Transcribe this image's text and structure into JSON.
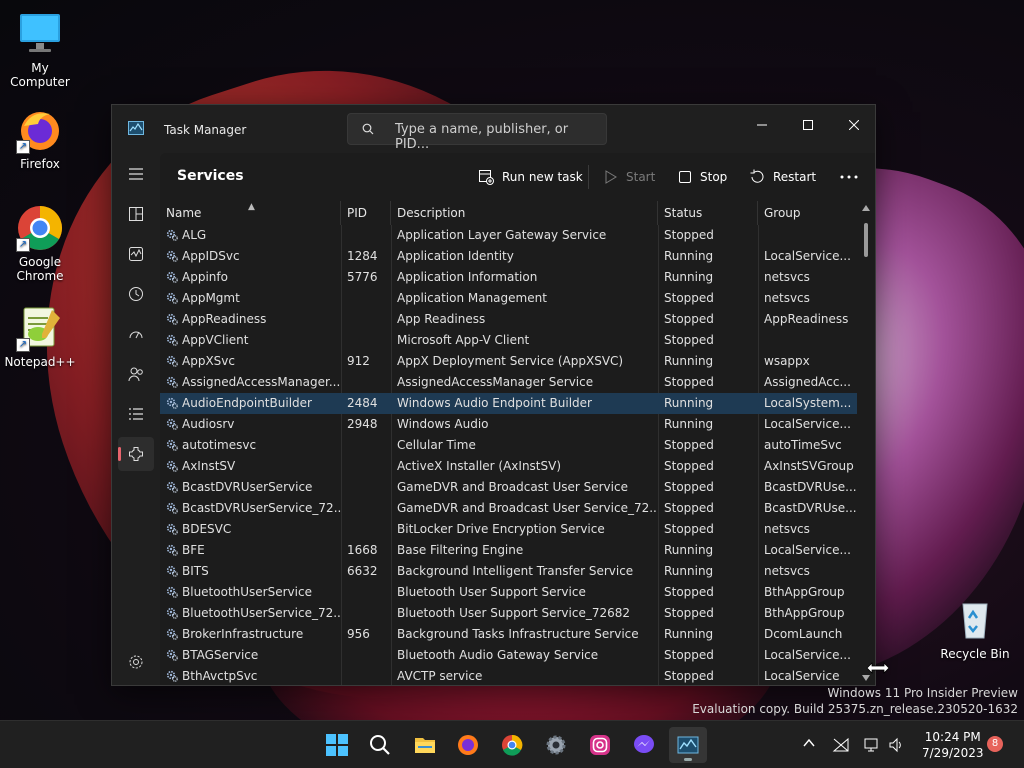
{
  "desktop": {
    "icons": [
      {
        "label": "My Computer"
      },
      {
        "label": "Firefox"
      },
      {
        "label": "Google Chrome"
      },
      {
        "label": "Notepad++"
      },
      {
        "label": "Recycle Bin"
      }
    ]
  },
  "window": {
    "title": "Task Manager",
    "search_placeholder": "Type a name, publisher, or PID..."
  },
  "toolbar": {
    "page_title": "Services",
    "run_new_task": "Run new task",
    "start": "Start",
    "stop": "Stop",
    "restart": "Restart"
  },
  "table": {
    "columns": [
      "Name",
      "PID",
      "Description",
      "Status",
      "Group"
    ],
    "selected_index": 8,
    "rows": [
      {
        "name": "ALG",
        "pid": "",
        "description": "Application Layer Gateway Service",
        "status": "Stopped",
        "group": ""
      },
      {
        "name": "AppIDSvc",
        "pid": "1284",
        "description": "Application Identity",
        "status": "Running",
        "group": "LocalService..."
      },
      {
        "name": "Appinfo",
        "pid": "5776",
        "description": "Application Information",
        "status": "Running",
        "group": "netsvcs"
      },
      {
        "name": "AppMgmt",
        "pid": "",
        "description": "Application Management",
        "status": "Stopped",
        "group": "netsvcs"
      },
      {
        "name": "AppReadiness",
        "pid": "",
        "description": "App Readiness",
        "status": "Stopped",
        "group": "AppReadiness"
      },
      {
        "name": "AppVClient",
        "pid": "",
        "description": "Microsoft App-V Client",
        "status": "Stopped",
        "group": ""
      },
      {
        "name": "AppXSvc",
        "pid": "912",
        "description": "AppX Deployment Service (AppXSVC)",
        "status": "Running",
        "group": "wsappx"
      },
      {
        "name": "AssignedAccessManager...",
        "pid": "",
        "description": "AssignedAccessManager Service",
        "status": "Stopped",
        "group": "AssignedAcc..."
      },
      {
        "name": "AudioEndpointBuilder",
        "pid": "2484",
        "description": "Windows Audio Endpoint Builder",
        "status": "Running",
        "group": "LocalSystem..."
      },
      {
        "name": "Audiosrv",
        "pid": "2948",
        "description": "Windows Audio",
        "status": "Running",
        "group": "LocalService..."
      },
      {
        "name": "autotimesvc",
        "pid": "",
        "description": "Cellular Time",
        "status": "Stopped",
        "group": "autoTimeSvc"
      },
      {
        "name": "AxInstSV",
        "pid": "",
        "description": "ActiveX Installer (AxInstSV)",
        "status": "Stopped",
        "group": "AxInstSVGroup"
      },
      {
        "name": "BcastDVRUserService",
        "pid": "",
        "description": "GameDVR and Broadcast User Service",
        "status": "Stopped",
        "group": "BcastDVRUse..."
      },
      {
        "name": "BcastDVRUserService_72...",
        "pid": "",
        "description": "GameDVR and Broadcast User Service_72...",
        "status": "Stopped",
        "group": "BcastDVRUse..."
      },
      {
        "name": "BDESVC",
        "pid": "",
        "description": "BitLocker Drive Encryption Service",
        "status": "Stopped",
        "group": "netsvcs"
      },
      {
        "name": "BFE",
        "pid": "1668",
        "description": "Base Filtering Engine",
        "status": "Running",
        "group": "LocalService..."
      },
      {
        "name": "BITS",
        "pid": "6632",
        "description": "Background Intelligent Transfer Service",
        "status": "Running",
        "group": "netsvcs"
      },
      {
        "name": "BluetoothUserService",
        "pid": "",
        "description": "Bluetooth User Support Service",
        "status": "Stopped",
        "group": "BthAppGroup"
      },
      {
        "name": "BluetoothUserService_72...",
        "pid": "",
        "description": "Bluetooth User Support Service_72682",
        "status": "Stopped",
        "group": "BthAppGroup"
      },
      {
        "name": "BrokerInfrastructure",
        "pid": "956",
        "description": "Background Tasks Infrastructure Service",
        "status": "Running",
        "group": "DcomLaunch"
      },
      {
        "name": "BTAGService",
        "pid": "",
        "description": "Bluetooth Audio Gateway Service",
        "status": "Stopped",
        "group": "LocalService..."
      },
      {
        "name": "BthAvctpSvc",
        "pid": "",
        "description": "AVCTP service",
        "status": "Stopped",
        "group": "LocalService"
      }
    ]
  },
  "watermark": {
    "line1": "Windows 11 Pro Insider Preview",
    "line2": "Evaluation copy. Build 25375.zn_release.230520-1632"
  },
  "taskbar": {
    "time": "10:24 PM",
    "date": "7/29/2023",
    "notification_count": "8"
  },
  "colors": {
    "accent": "#e8646d",
    "selection": "#1e3a53",
    "window_bg": "#1f1f1f"
  }
}
